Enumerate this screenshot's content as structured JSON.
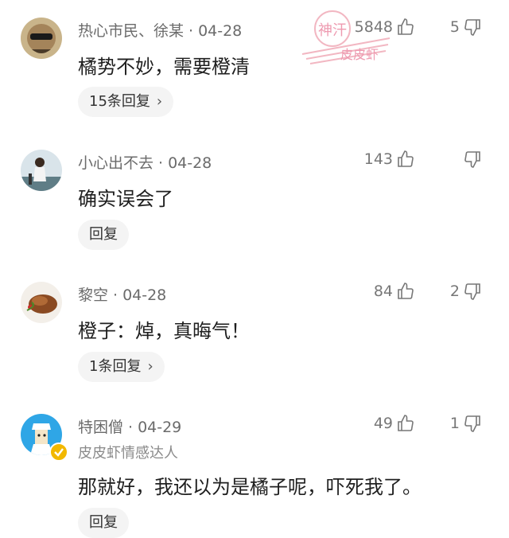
{
  "watermark": {
    "top": "神汗",
    "bottom": "皮皮虾"
  },
  "comments": [
    {
      "user": "热心市民、徐某",
      "date": "04-28",
      "text": "橘势不妙，需要橙清",
      "likes": "5848",
      "dislikes": "5",
      "reply_label": "15条回复",
      "has_chevron": true
    },
    {
      "user": "小心出不去",
      "date": "04-28",
      "text": "确实误会了",
      "likes": "143",
      "dislikes": "",
      "reply_label": "回复",
      "has_chevron": false
    },
    {
      "user": "黎空",
      "date": "04-28",
      "text": "橙子：焯，真晦气！",
      "likes": "84",
      "dislikes": "2",
      "reply_label": "1条回复",
      "has_chevron": true
    },
    {
      "user": "特困僧",
      "date": "04-29",
      "subtitle": "皮皮虾情感达人",
      "text": "那就好，我还以为是橘子呢，吓死我了。",
      "likes": "49",
      "dislikes": "1",
      "reply_label": "回复",
      "has_chevron": false
    }
  ],
  "separator": "·",
  "chevron": "›",
  "badge_icon": "check-icon"
}
